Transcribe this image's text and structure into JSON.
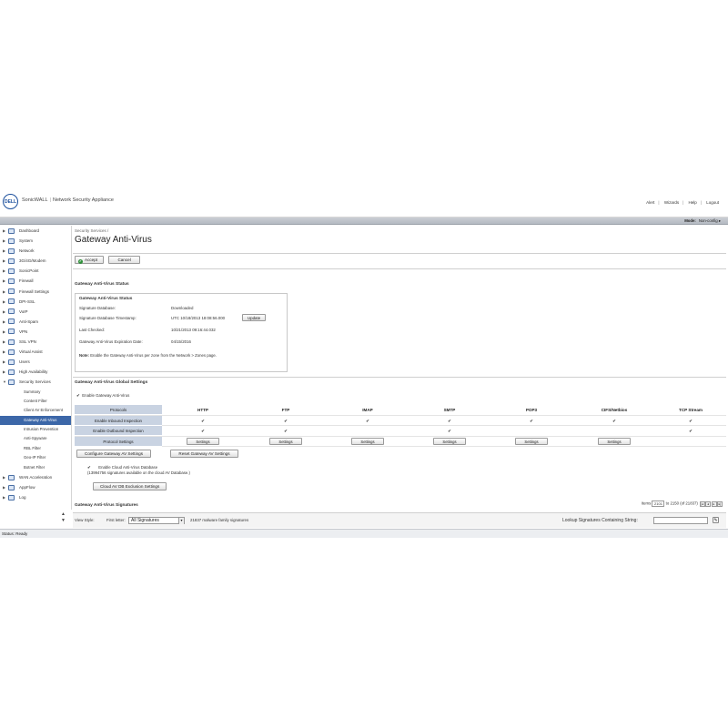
{
  "header": {
    "logo_text": "DELL",
    "brand": "SonicWALL",
    "product": "Network Security Appliance",
    "links": [
      "Alert",
      "Wizards",
      "Help",
      "Logout"
    ],
    "mode_label": "Mode:",
    "mode_value": "Non-config ▸"
  },
  "sidebar": {
    "items": [
      {
        "label": "Dashboard",
        "icon": "dashboard-icon"
      },
      {
        "label": "System",
        "icon": "system-icon"
      },
      {
        "label": "Network",
        "icon": "network-icon"
      },
      {
        "label": "3G/4G/Modem",
        "icon": "modem-icon"
      },
      {
        "label": "SonicPoint",
        "icon": "sonicpoint-icon"
      },
      {
        "label": "Firewall",
        "icon": "firewall-icon"
      },
      {
        "label": "Firewall Settings",
        "icon": "firewall-settings-icon"
      },
      {
        "label": "DPI-SSL",
        "icon": "dpi-ssl-icon"
      },
      {
        "label": "VoIP",
        "icon": "voip-icon"
      },
      {
        "label": "Anti-Spam",
        "icon": "anti-spam-icon"
      },
      {
        "label": "VPN",
        "icon": "vpn-icon"
      },
      {
        "label": "SSL VPN",
        "icon": "ssl-vpn-icon"
      },
      {
        "label": "Virtual Assist",
        "icon": "virtual-assist-icon"
      },
      {
        "label": "Users",
        "icon": "users-icon"
      },
      {
        "label": "High Availability",
        "icon": "high-availability-icon"
      },
      {
        "label": "Security Services",
        "icon": "security-services-icon"
      }
    ],
    "sub_items": [
      "Summary",
      "Content Filter",
      "Client AV Enforcement",
      "Gateway Anti-Virus",
      "Intrusion Prevention",
      "Anti-Spyware",
      "RBL Filter",
      "Geo-IP Filter",
      "Botnet Filter"
    ],
    "after_items": [
      {
        "label": "WAN Acceleration",
        "icon": "wan-acceleration-icon"
      },
      {
        "label": "AppFlow",
        "icon": "appflow-icon"
      },
      {
        "label": "Log",
        "icon": "log-icon"
      }
    ]
  },
  "main": {
    "breadcrumb": "Security Services /",
    "title": "Gateway Anti-Virus",
    "accept_label": "Accept",
    "cancel_label": "Cancel",
    "status_section_title": "Gateway Anti-Virus Status",
    "status_box": {
      "title": "Gateway Anti-Virus Status",
      "rows": [
        {
          "label": "Signature Database:",
          "value": "Downloaded"
        },
        {
          "label": "Signature Database Timestamp:",
          "value": "UTC 10/18/2013 18:08:56.000"
        },
        {
          "label": "Last Checked:",
          "value": "10/21/2013 09:16:44.032"
        },
        {
          "label": "Gateway Anti-Virus Expiration Date:",
          "value": "04/15/2016"
        }
      ],
      "update_label": "Update",
      "note_bold": "Note:",
      "note_text": "Enable the Gateway Anti-Virus per zone from the Network > Zones page."
    },
    "global_section_title": "Gateway Anti-Virus Global Settings",
    "enable_gav_label": "Enable Gateway Anti-Virus",
    "protocols_label": "Protocols",
    "protocols": [
      "HTTP",
      "FTP",
      "IMAP",
      "SMTP",
      "POP3",
      "CIFS/Netbios",
      "TCP Stream"
    ],
    "inbound_label": "Enable Inbound Inspection",
    "outbound_label": "Enable Outbound Inspection",
    "protocol_settings_label": "Protocol Settings",
    "settings_label": "Settings",
    "configure_label": "Configure Gateway AV Settings",
    "reset_label": "Reset Gateway AV Settings",
    "cloud_enable_label": "Enable Cloud Anti-Virus Database",
    "cloud_note": "(13994756 signatures available on the cloud AV Database.)",
    "cloud_exclusion_label": "Cloud AV DB Exclusion Settings",
    "signatures_title": "Gateway Anti-Virus Signatures",
    "pager": {
      "items_label": "Items",
      "from": "2101",
      "range_text": "to 2150 (of 21837)"
    },
    "view_style_label": "View Style:",
    "first_letter_label": "First letter:",
    "first_letter_value": "All Signatures",
    "family_count_text": "21837 malware family signatures",
    "lookup_label": "Lookup Signatures Containing String:"
  },
  "statusbar": {
    "text": "Status: Ready"
  }
}
